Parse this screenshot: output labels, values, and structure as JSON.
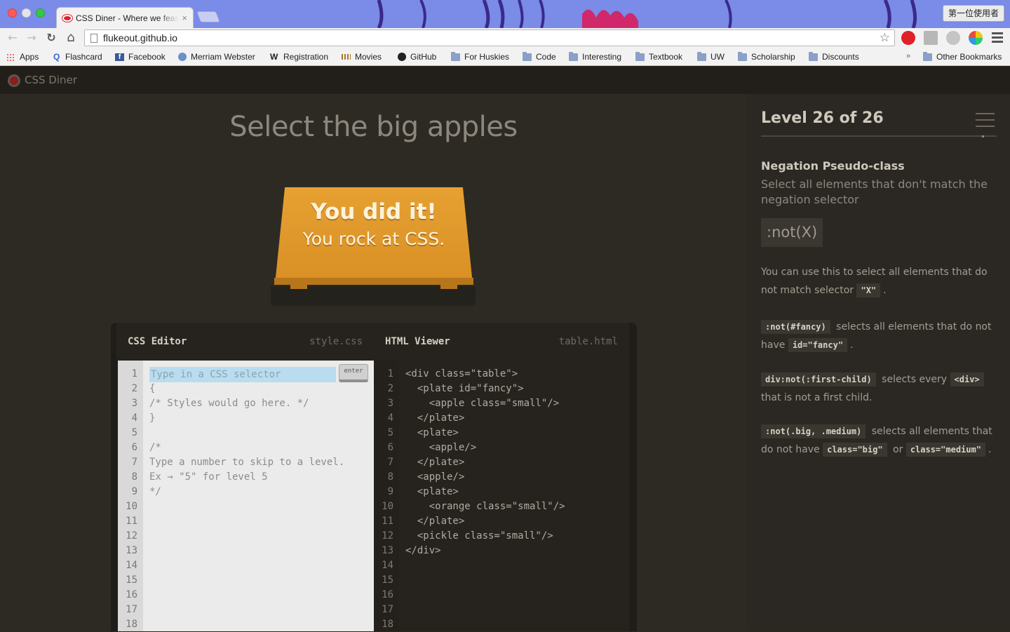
{
  "browser": {
    "tab_title": "CSS Diner - Where we feast on CSS",
    "tab_close": "×",
    "profile_label": "第一位使用者",
    "url": "flukeout.github.io",
    "nav": {
      "back": "←",
      "forward": "→",
      "reload": "↻",
      "home": "⌂",
      "star": "☆"
    },
    "bookmarks": [
      {
        "label": "Apps",
        "icon": "apps-icon"
      },
      {
        "label": "Flashcard",
        "icon": "quizlet-icon"
      },
      {
        "label": "Facebook",
        "icon": "facebook-icon"
      },
      {
        "label": "Merriam Webster",
        "icon": "globe-icon"
      },
      {
        "label": "Registration",
        "icon": "w-icon"
      },
      {
        "label": "Movies",
        "icon": "movies-icon"
      },
      {
        "label": "GitHub",
        "icon": "github-icon"
      },
      {
        "label": "For Huskies",
        "icon": "folder-icon"
      },
      {
        "label": "Code",
        "icon": "folder-icon"
      },
      {
        "label": "Interesting",
        "icon": "folder-icon"
      },
      {
        "label": "Textbook",
        "icon": "folder-icon"
      },
      {
        "label": "UW",
        "icon": "folder-icon"
      },
      {
        "label": "Scholarship",
        "icon": "folder-icon"
      },
      {
        "label": "Discounts",
        "icon": "folder-icon"
      }
    ],
    "bookmarks_more": "»",
    "other_bookmarks": "Other Bookmarks"
  },
  "site": {
    "title": "CSS Diner"
  },
  "main": {
    "instruction": "Select the big apples",
    "win_line1": "You did it!",
    "win_line2": "You rock at CSS."
  },
  "editor": {
    "css_title": "CSS Editor",
    "css_file": "style.css",
    "html_title": "HTML Viewer",
    "html_file": "table.html",
    "input_placeholder": "Type in a CSS selector",
    "enter_label": "enter",
    "css_lines": [
      "",
      "{",
      "/* Styles would go here. */",
      "}",
      "",
      "/*",
      "Type a number to skip to a level.",
      "Ex → \"5\" for level 5",
      "*/"
    ],
    "html_lines": [
      "<div class=\"table\">",
      "  <plate id=\"fancy\">",
      "    <apple class=\"small\"/>",
      "  </plate>",
      "  <plate>",
      "    <apple/>",
      "  </plate>",
      "  <apple/>",
      "  <plate>",
      "    <orange class=\"small\"/>",
      "  </plate>",
      "  <pickle class=\"small\"/>",
      "</div>"
    ],
    "line_numbers": [
      "1",
      "2",
      "3",
      "4",
      "5",
      "6",
      "7",
      "8",
      "9",
      "10",
      "11",
      "12",
      "13",
      "14",
      "15",
      "16",
      "17",
      "18"
    ]
  },
  "sidebar": {
    "level_title": "Level 26 of 26",
    "progress_fraction": 1,
    "selector_name": "Negation Pseudo-class",
    "selector_title": "Select all elements that don't match the negation selector",
    "syntax": ":not(X)",
    "hint1_text": "You can use this to select all elements that do not match selector",
    "hint1_chip": "\"X\"",
    "hint1_end": ".",
    "ex1_chip": ":not(#fancy)",
    "ex1_text": "selects all elements that do not have",
    "ex1_chip2": "id=\"fancy\"",
    "ex1_end": ".",
    "ex2_chip": "div:not(:first-child)",
    "ex2_text": "selects every",
    "ex2_chip2": "<div>",
    "ex2_text2": "that is not a first child.",
    "ex3_chip": ":not(.big, .medium)",
    "ex3_text": "selects all elements that do not have",
    "ex3_chip2": "class=\"big\"",
    "ex3_or": "or",
    "ex3_chip3": "class=\"medium\"",
    "ex3_end": "."
  },
  "colors": {
    "accent_orange": "#e6a132",
    "background": "#2d2a23",
    "input_highlight": "#b9dcef"
  }
}
